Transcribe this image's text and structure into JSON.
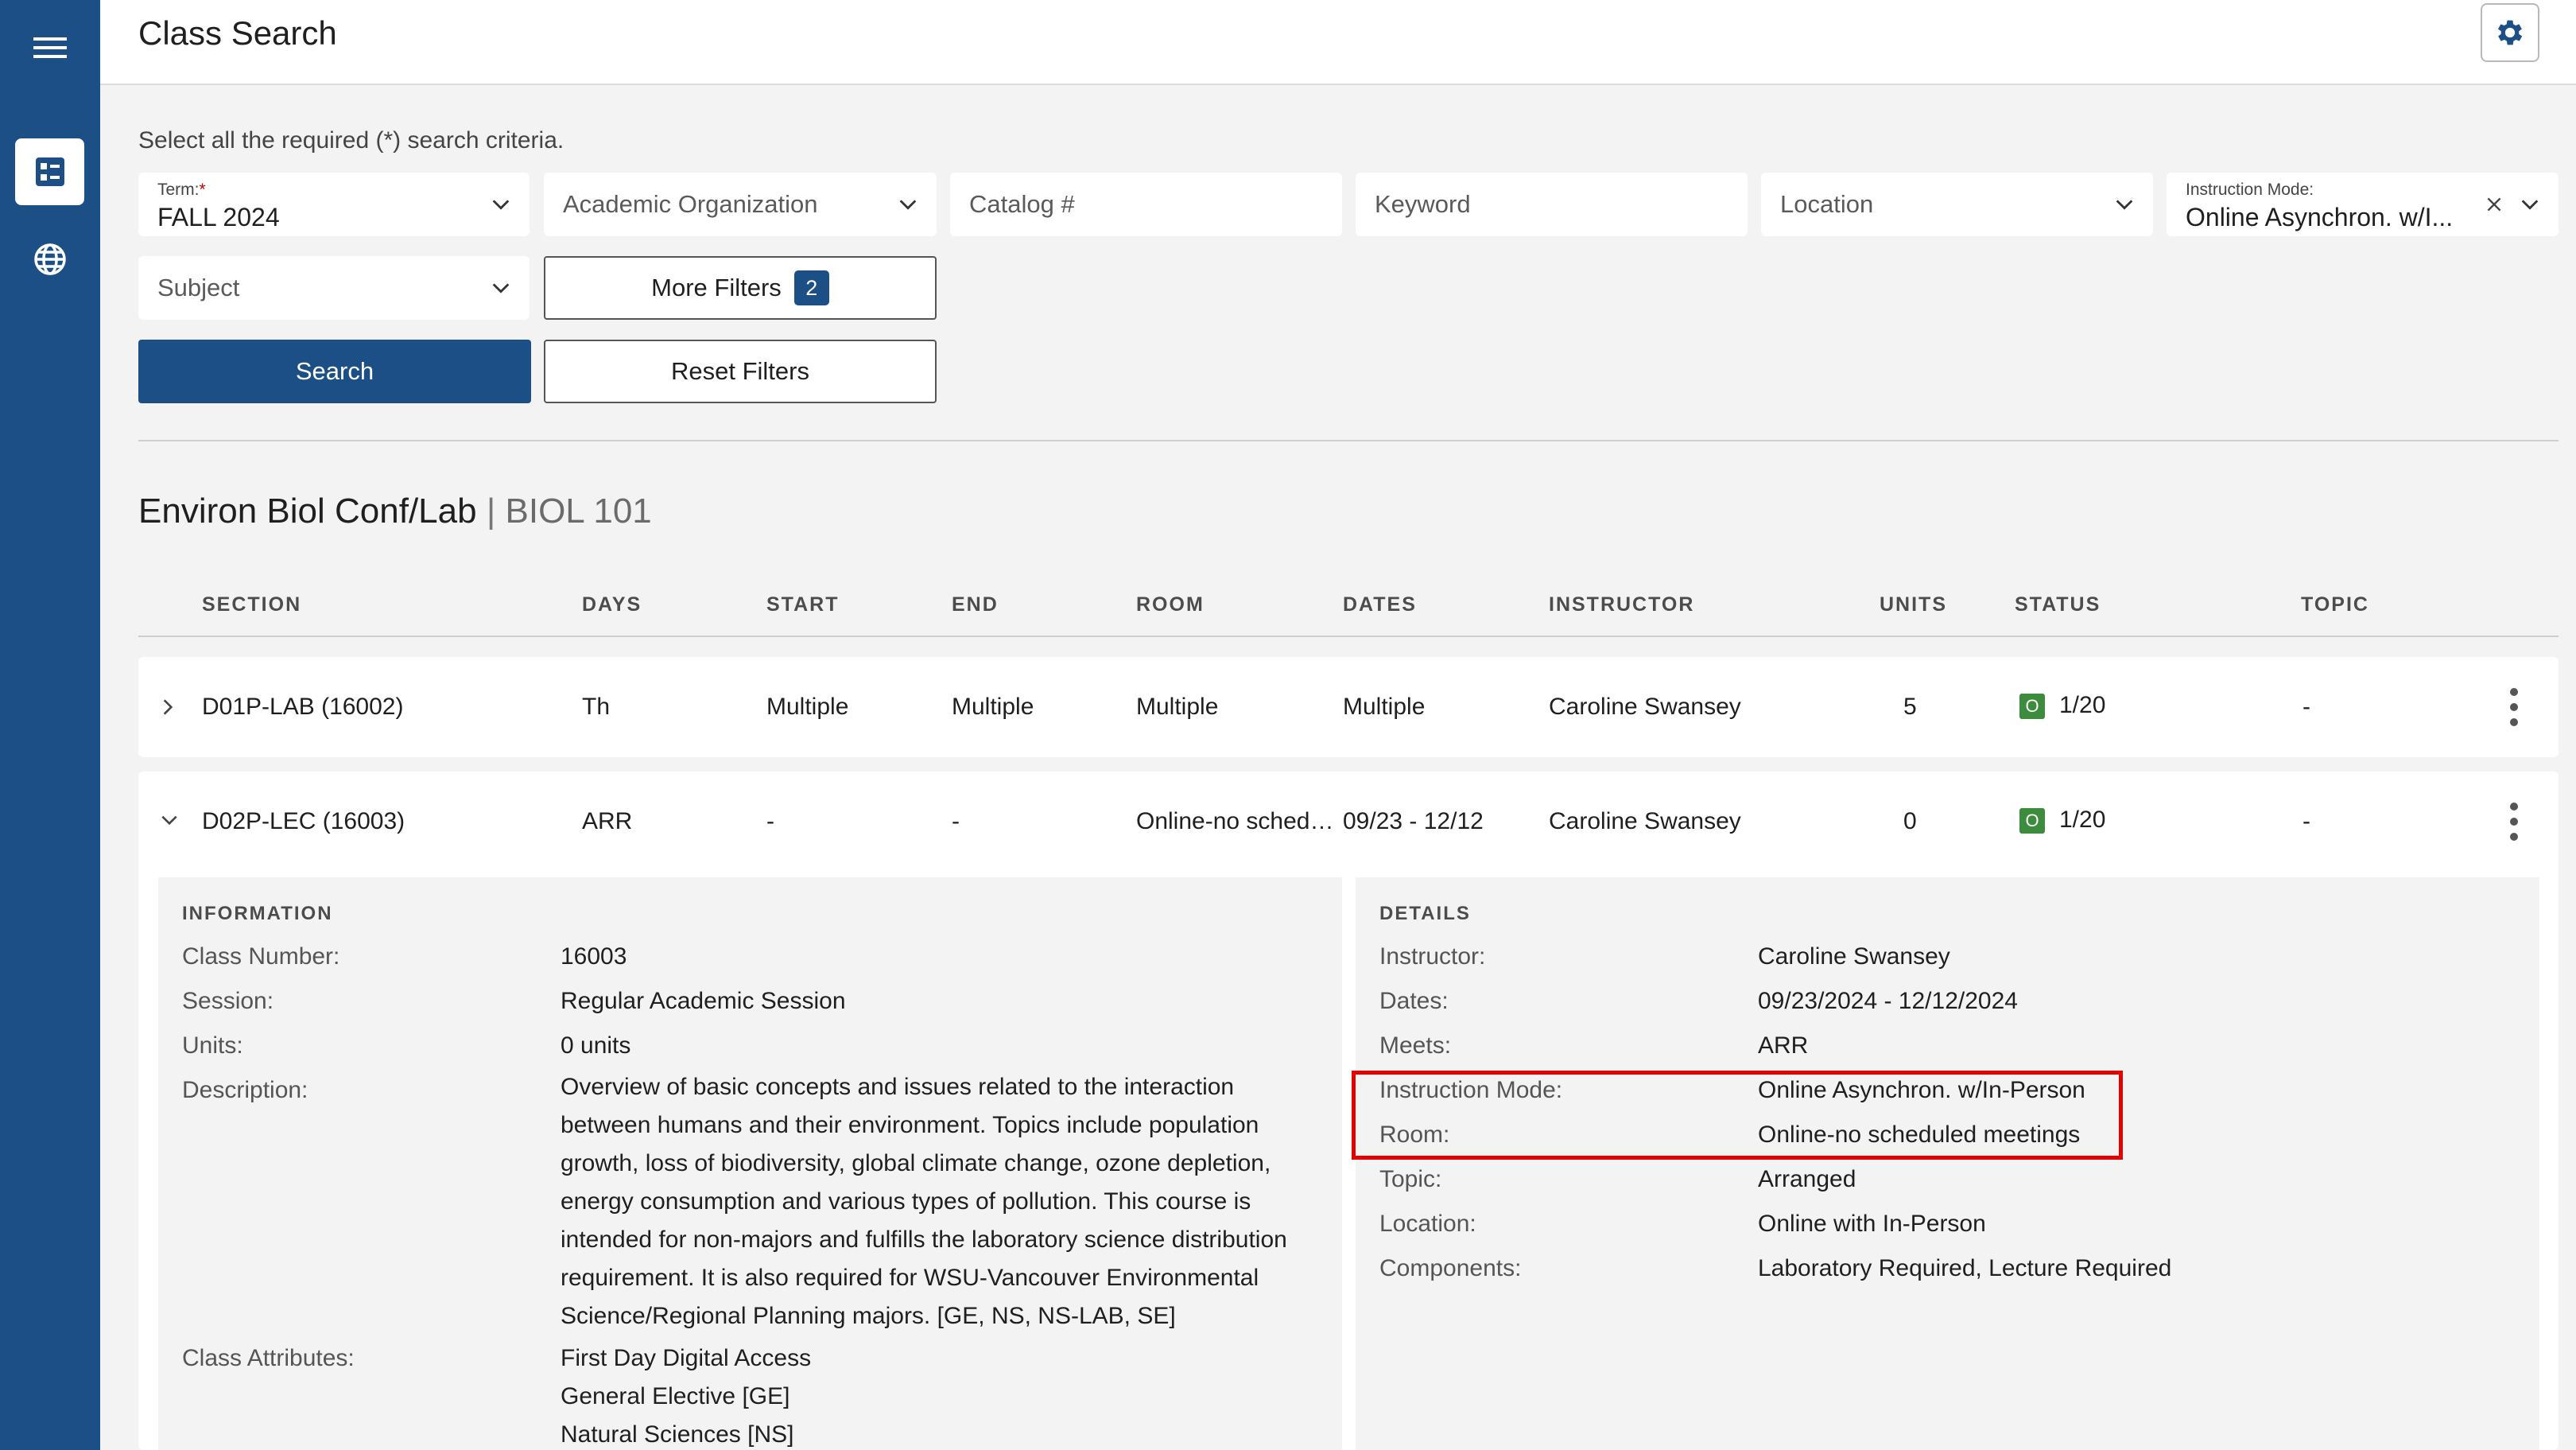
{
  "header": {
    "title": "Class Search"
  },
  "search": {
    "hint": "Select all the required (*) search criteria.",
    "term_label": "Term:",
    "term_required": "*",
    "term_value": "FALL 2024",
    "academic_org": "Academic Organization",
    "catalog": "Catalog #",
    "keyword": "Keyword",
    "location": "Location",
    "instruction_mode_label": "Instruction Mode:",
    "instruction_mode_value": "Online Asynchron. w/I...",
    "subject": "Subject",
    "more_filters": "More Filters",
    "more_filters_count": "2",
    "search_btn": "Search",
    "reset_btn": "Reset Filters"
  },
  "course": {
    "name": "Environ Biol Conf/Lab",
    "separator": "|",
    "code": "BIOL 101"
  },
  "table": {
    "headers": [
      "SECTION",
      "DAYS",
      "START",
      "END",
      "ROOM",
      "DATES",
      "INSTRUCTOR",
      "UNITS",
      "STATUS",
      "TOPIC"
    ],
    "rows": [
      {
        "section": "D01P-LAB (16002)",
        "days": "Th",
        "start": "Multiple",
        "end": "Multiple",
        "room": "Multiple",
        "dates": "Multiple",
        "instructor": "Caroline Swansey",
        "units": "5",
        "status_icon": "O",
        "status": "1/20",
        "topic": "-"
      },
      {
        "section": "D02P-LEC (16003)",
        "days": "ARR",
        "start": "-",
        "end": "-",
        "room": "Online-no sched…",
        "dates": "09/23 - 12/12",
        "instructor": "Caroline Swansey",
        "units": "0",
        "status_icon": "O",
        "status": "1/20",
        "topic": "-"
      }
    ]
  },
  "information": {
    "heading": "INFORMATION",
    "class_number_label": "Class Number:",
    "class_number": "16003",
    "session_label": "Session:",
    "session": "Regular Academic Session",
    "units_label": "Units:",
    "units": "0 units",
    "description_label": "Description:",
    "description": "Overview of basic concepts and issues related to the interaction between humans and their environment. Topics include population growth, loss of biodiversity, global climate change, ozone depletion, energy consumption and various types of pollution. This course is intended for non-majors and fulfills the laboratory science distribution requirement. It is also required for WSU-Vancouver Environmental Science/Regional Planning majors. [GE, NS, NS-LAB, SE]",
    "attributes_label": "Class Attributes:",
    "attributes": [
      "First Day Digital Access",
      "General Elective [GE]",
      "Natural Sciences [NS]"
    ]
  },
  "details": {
    "heading": "DETAILS",
    "instructor_label": "Instructor:",
    "instructor": "Caroline Swansey",
    "dates_label": "Dates:",
    "dates": "09/23/2024 - 12/12/2024",
    "meets_label": "Meets:",
    "meets": "ARR",
    "mode_label": "Instruction Mode:",
    "mode": "Online Asynchron. w/In-Person",
    "room_label": "Room:",
    "room": "Online-no scheduled meetings",
    "topic_label": "Topic:",
    "topic": "Arranged",
    "location_label": "Location:",
    "location": "Online with In-Person",
    "components_label": "Components:",
    "components": "Laboratory Required, Lecture Required"
  },
  "colors": {
    "brand": "#1b4f85",
    "status_open": "#3d8b3d",
    "highlight": "#e30000"
  }
}
